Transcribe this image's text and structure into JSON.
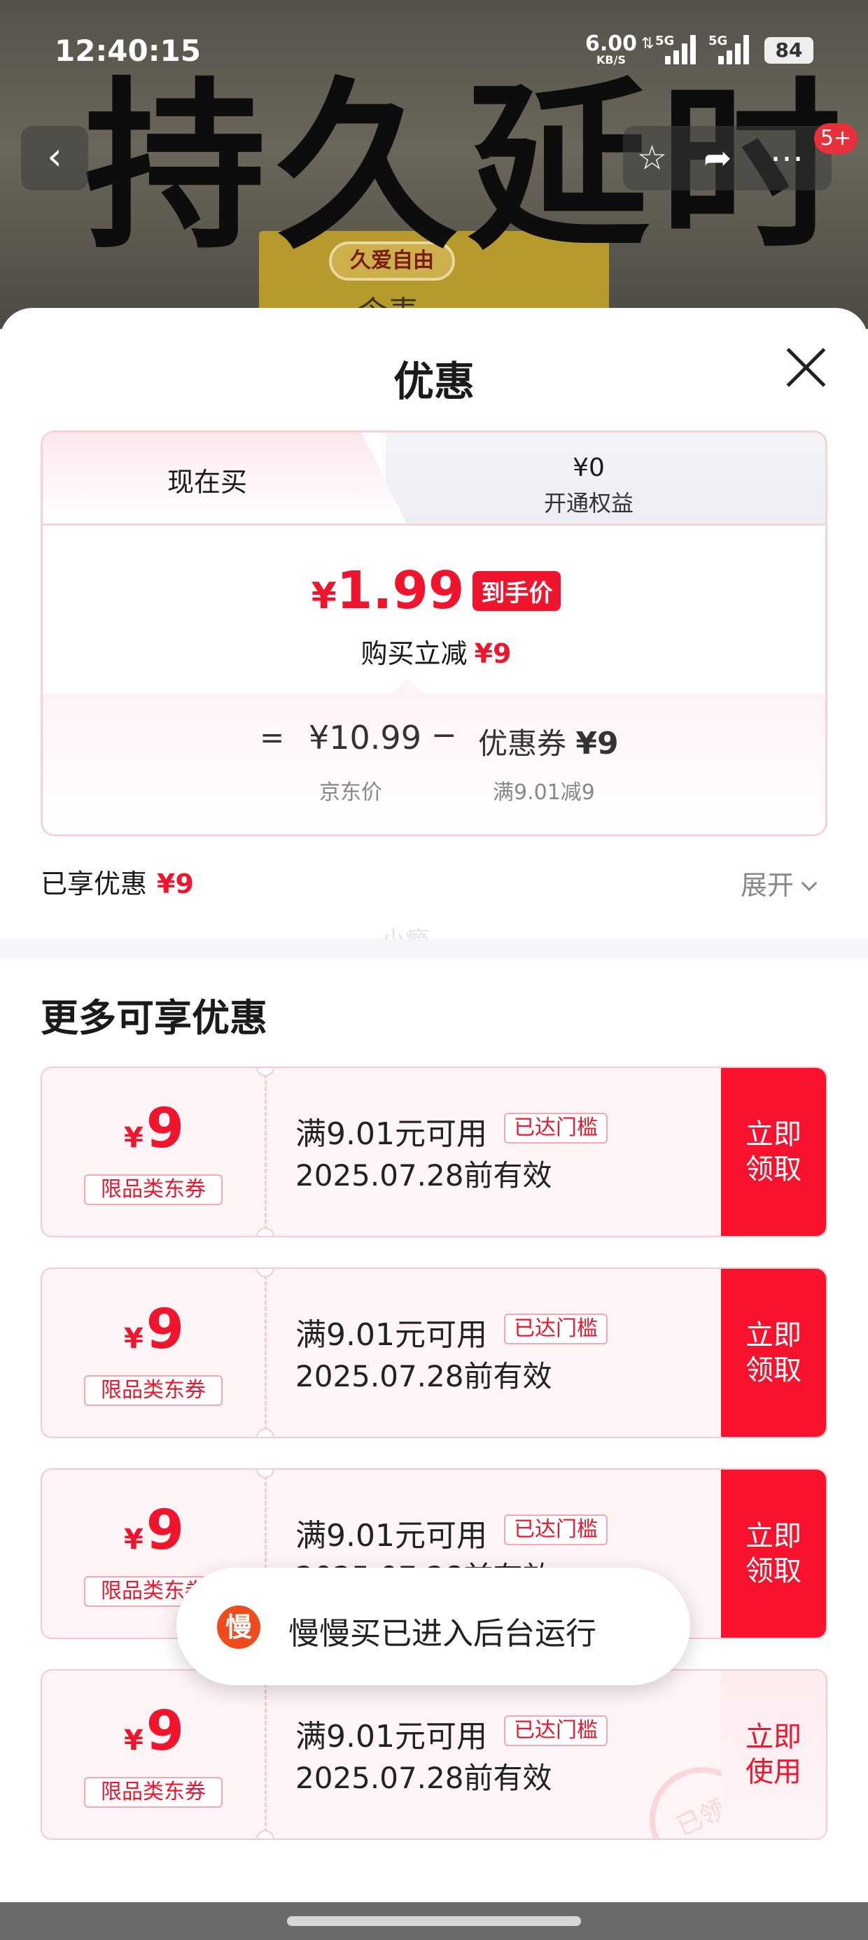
{
  "status_bar": {
    "time": "12:40:15",
    "net_speed": "6.00",
    "net_unit": "KB/S",
    "signal1": "5G",
    "signal2": "5G",
    "battery": "84"
  },
  "hero": {
    "headline": "持久延时",
    "box_label": "久爱自由",
    "box_sub": "令麦",
    "cart_badge": "5+"
  },
  "sheet": {
    "title": "优惠",
    "tabs": [
      {
        "label": "现在买"
      },
      {
        "price": "¥0",
        "label": "开通权益"
      }
    ],
    "price": {
      "currency": "¥",
      "value": "1.99",
      "tag": "到手价",
      "reduce_label": "购买立减",
      "reduce_amount": "¥9"
    },
    "calc": {
      "equals": "=",
      "jd_price": "¥10.99",
      "minus": "−",
      "coupon_label": "优惠券",
      "coupon_amount": "¥9",
      "jd_price_label": "京东价",
      "coupon_rule": "满9.01减9"
    },
    "enjoyed_label": "已享优惠",
    "enjoyed_amount": "¥9",
    "expand_label": "展开",
    "watermark": "小瘾",
    "more_title": "更多可享优惠"
  },
  "coupons": [
    {
      "currency": "¥",
      "amount": "9",
      "kind": "限品类东券",
      "condition": "满9.01元可用",
      "threshold": "已达门槛",
      "valid": "2025.07.28前有效",
      "action": "立即领取"
    },
    {
      "currency": "¥",
      "amount": "9",
      "kind": "限品类东券",
      "condition": "满9.01元可用",
      "threshold": "已达门槛",
      "valid": "2025.07.28前有效",
      "action": "立即领取"
    },
    {
      "currency": "¥",
      "amount": "9",
      "kind": "限品类东券",
      "condition": "满9.01元可用",
      "threshold": "已达门槛",
      "valid": "2025.07.28前有效",
      "action": "立即领取"
    },
    {
      "currency": "¥",
      "amount": "9",
      "kind": "限品类东券",
      "condition": "满9.01元可用",
      "threshold": "已达门槛",
      "valid": "2025.07.28前有效",
      "action": "立即使用",
      "stamp": "已领"
    }
  ],
  "toast": {
    "icon_char": "慢",
    "text": "慢慢买已进入后台运行"
  },
  "colors": {
    "accent_red": "#f0142d",
    "coupon_button_red": "#f9122d",
    "toast_icon": "#f04b1e"
  }
}
